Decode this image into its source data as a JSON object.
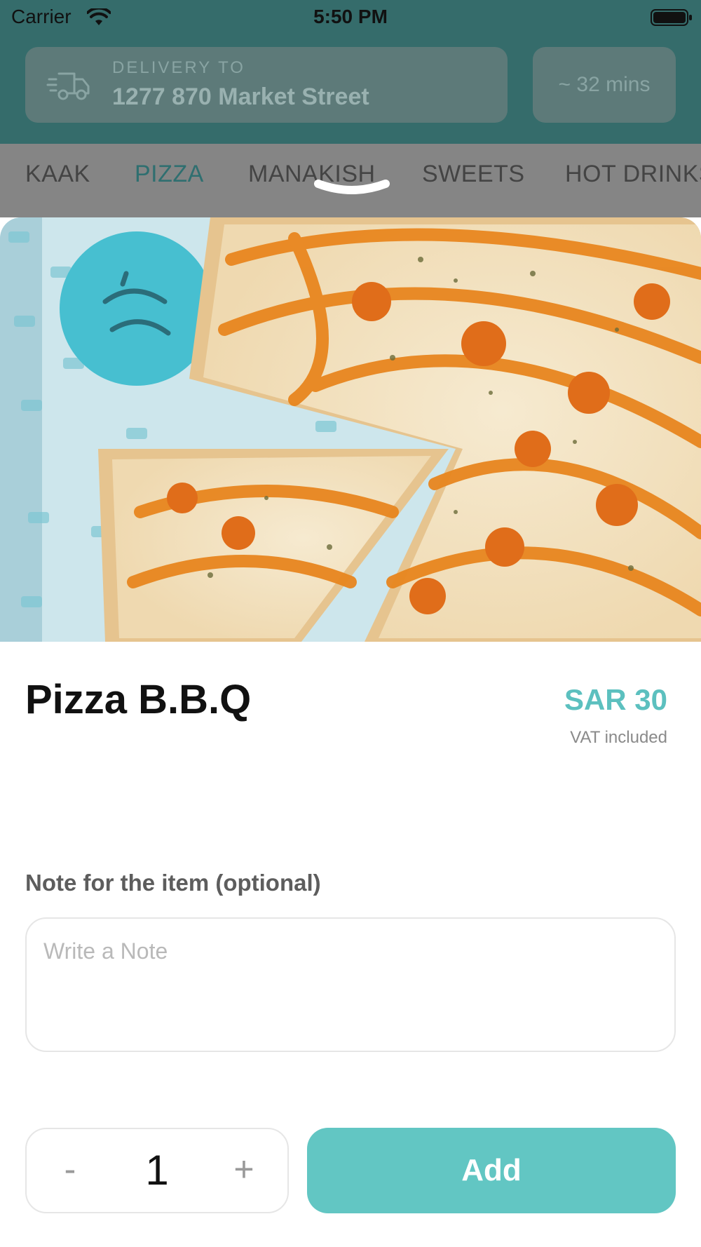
{
  "status_bar": {
    "carrier": "Carrier",
    "time": "5:50 PM"
  },
  "header": {
    "delivery_label": "DELIVERY TO",
    "delivery_address": "1277 870 Market Street",
    "eta": "~ 32 mins"
  },
  "categories": [
    {
      "label": "KAAK",
      "active": false
    },
    {
      "label": "PIZZA",
      "active": true
    },
    {
      "label": "MANAKISH",
      "active": false
    },
    {
      "label": "SWEETS",
      "active": false
    },
    {
      "label": "HOT DRINKS",
      "active": false
    }
  ],
  "item": {
    "title": "Pizza B.B.Q",
    "price": "SAR 30",
    "vat_note": "VAT included"
  },
  "note": {
    "label": "Note for the item (optional)",
    "placeholder": "Write a Note",
    "value": ""
  },
  "quantity": {
    "minus_label": "-",
    "value": "1",
    "plus_label": "+"
  },
  "add_button_label": "Add",
  "colors": {
    "accent": "#62c6c3",
    "price": "#5cc0bf",
    "header": "#356c6b",
    "active_tab": "#2f6f70"
  }
}
